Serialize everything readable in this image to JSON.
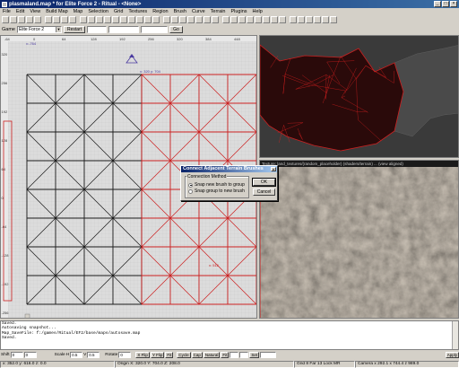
{
  "window": {
    "title": "plasmaland.map * for Elite Force 2 - Ritual - <None>",
    "buttons": {
      "minimize": "_",
      "maximize": "□",
      "close": "×"
    }
  },
  "menu": [
    "File",
    "Edit",
    "View",
    "Build Map",
    "Map",
    "Selection",
    "Grid",
    "Textures",
    "Region",
    "Brush",
    "Curve",
    "Terrain",
    "Plugins",
    "Help"
  ],
  "game_bar": {
    "label": "Game",
    "game": "Elite Force 2",
    "restart": "Restart",
    "go": "Go"
  },
  "view2d": {
    "top_ticks": [
      "-64",
      "0",
      "64",
      "128",
      "192",
      "256",
      "320",
      "384",
      "448",
      "512",
      "576"
    ],
    "left_ticks": [
      "320",
      "256",
      "192",
      "128",
      "64",
      "0",
      "-64",
      "-128",
      "-192",
      "-256"
    ],
    "origin_label": "x:-764",
    "camera_label": "x: 320 y: 704",
    "size_label": "x: 512",
    "colors": {
      "grid_black": "#1a1a1a",
      "selected_red": "#cc2020",
      "background": "#dcdcdc",
      "camera": "#4a3aa0"
    }
  },
  "view3d_bottom": {
    "header": "Texture: land_textures/(random_placeholder) (shaders/terrain) ...  (view aligned)"
  },
  "dialog": {
    "title": "Connect Adjacent Terrain Brushes",
    "close": "×",
    "group_label": "Connection Method",
    "options": [
      "Snap new brush to group",
      "Snap group to new brush"
    ],
    "selected_index": 0,
    "ok": "OK",
    "cancel": "Cancel"
  },
  "console": [
    "Saved.",
    "Autosaving snapshot...",
    "Map_SaveFile: f:/games/Ritual/EF2/base/maps/autosave.map",
    "Saved."
  ],
  "options_bar": {
    "shift_label": "Shift",
    "shift_x": "0",
    "shift_y": "0",
    "scale_label": "Scale",
    "scale_h_label": "H",
    "scale_h": "0.5",
    "scale_v_label": "V",
    "scale_v": "0.5",
    "rotate_label": "Rotate",
    "rotate": "0",
    "xflip": "X Flip",
    "yflip": "Y Flip",
    "fit": "Fit",
    "cycle": "Cycle",
    "cap": "Cap",
    "natural": "Natural",
    "fit2": "Fit",
    "set": "Set",
    "apply": "Apply"
  },
  "status": {
    "coords": "x: 352.0  y: 616.0  z: 0.0",
    "origin": "Origin X: 320.0  Y: 704.0  Z: 208.0",
    "grid": "Grid 8 Far 13 Lock MR",
    "camera": "Camera x 292.1 x 744.4 z 989.0"
  }
}
